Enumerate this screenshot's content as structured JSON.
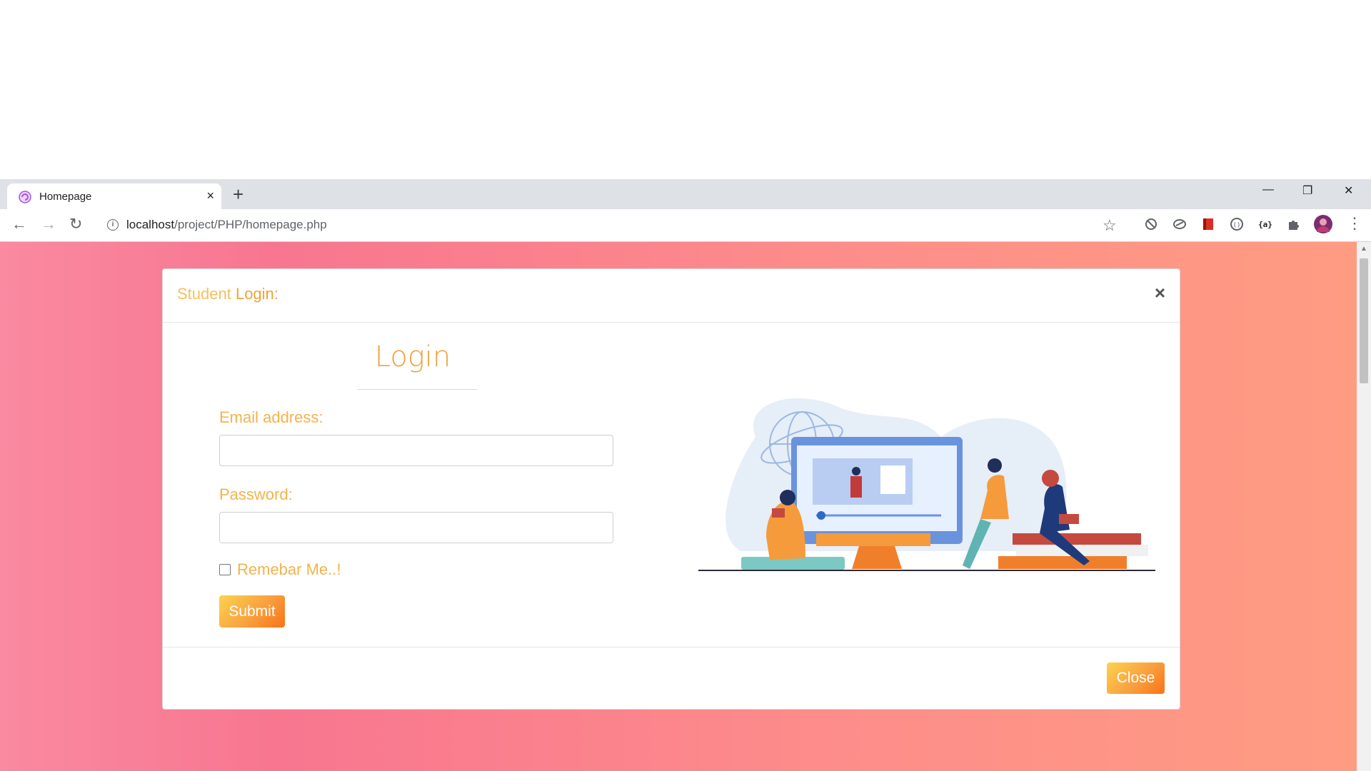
{
  "browser": {
    "tab_title": "Homepage",
    "tab_close": "×",
    "new_tab": "+",
    "window_controls": {
      "minimize": "—",
      "restore": "❐",
      "close": "✕"
    },
    "nav": {
      "back": "←",
      "forward": "→",
      "reload": "↻"
    },
    "url_host": "localhost",
    "url_path": "/project/PHP/homepage.php",
    "star_icon": "☆",
    "extension_icons": [
      "block-icon",
      "extension-icon",
      "bookmark-extension-icon",
      "code-extension-icon",
      "json-extension-icon",
      "puzzle-icon",
      "avatar",
      "menu-kebab-icon"
    ],
    "menu_glyph": "⋮"
  },
  "modal": {
    "title_part1": "Student",
    "title_part2": " Login:",
    "close_glyph": "×",
    "heading": "Login",
    "email_label": "Email address:",
    "email_value": "",
    "password_label": "Password:",
    "password_value": "",
    "remember_label": "Remebar Me..!",
    "remember_checked": false,
    "submit_label": "Submit",
    "footer_close_label": "Close"
  },
  "colors": {
    "accent_orange": "#f0a23a",
    "label_orange": "#f4b34a",
    "bg_gradient_start": "#f98aa0",
    "bg_gradient_end": "#fe9c82"
  }
}
